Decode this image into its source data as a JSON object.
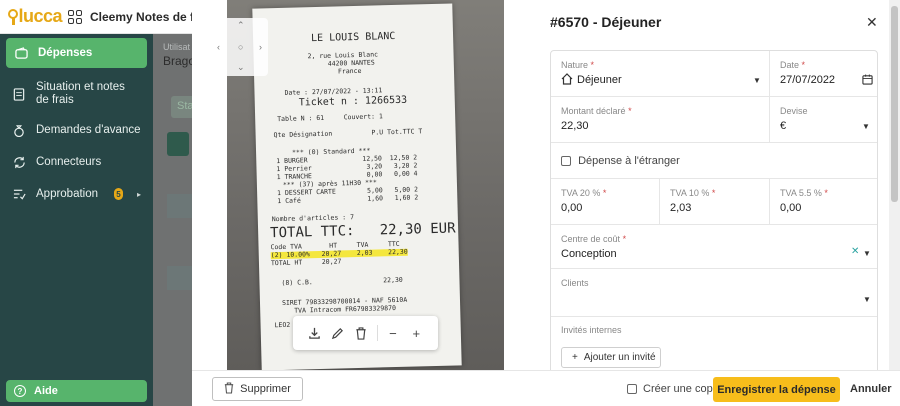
{
  "header": {
    "logo_text": "lucca",
    "app_title": "Cleemy Notes de frais"
  },
  "sidebar": {
    "items": [
      {
        "label": "Dépenses",
        "icon": "wallet-icon",
        "active": true
      },
      {
        "label": "Situation et notes de frais",
        "icon": "document-icon"
      },
      {
        "label": "Demandes d'avance",
        "icon": "moneybag-icon"
      },
      {
        "label": "Connecteurs",
        "icon": "sync-icon"
      },
      {
        "label": "Approbation",
        "icon": "checklist-icon",
        "badge": "5"
      }
    ],
    "help_label": "Aide"
  },
  "background": {
    "user_label": "Utilisat",
    "user_name": "Bragou",
    "tag": "Sta"
  },
  "receipt": {
    "restaurant": "LE LOUIS BLANC",
    "address": "2, rue Louis Blanc",
    "city": "44200 NANTES",
    "country": "France",
    "date_line": "Date : 27/07/2022 - 13:11",
    "ticket": "Ticket n : 1266533",
    "table_line": "Table N : 61     Couvert: 1",
    "columns": "Qte Désignation          P.U Tot.TTC T",
    "standard": "*** (0) Standard ***",
    "line1": "1 BURGER              12,50  12,50 2",
    "line2": "1 Perrier              3,20   3,20 2",
    "line3": "1 TRANCHE              0,00   0,00 4",
    "apres": "*** (37) après 11H30 ***",
    "line4": "1 DESSERT CARTE        5,00   5,00 2",
    "line5": "1 Café                 1,60   1,60 2",
    "nb_articles": "Nombre d'articles : 7",
    "total": "TOTAL TTC:   22,30 EUR",
    "tva_head": "Code TVA       HT     TVA     TTC",
    "tva_row": "(2) 10.00%   20,27    2,03    22,30",
    "total_ht": "TOTAL HT     20,27",
    "payment": "(8) C.B.                  22,30",
    "siret": "SIRET 79833298700014 - NAF 5610A",
    "tva_intra": "TVA Intracom FR67983329870",
    "leo": "LEO2"
  },
  "viewer_tools": [
    "download-icon",
    "pencil-icon",
    "trash-icon",
    "zoom-out-icon",
    "zoom-in-icon"
  ],
  "form": {
    "title": "#6570 - Déjeuner",
    "nature_label": "Nature",
    "nature_value": "Déjeuner",
    "date_label": "Date",
    "date_value": "27/07/2022",
    "amount_label": "Montant déclaré",
    "amount_value": "22,30",
    "currency_label": "Devise",
    "currency_value": "€",
    "abroad_label": "Dépense à l'étranger",
    "tva20_label": "TVA 20 %",
    "tva20_value": "0,00",
    "tva10_label": "TVA 10 %",
    "tva10_value": "2,03",
    "tva55_label": "TVA 5.5 %",
    "tva55_value": "0,00",
    "cost_center_label": "Centre de coût",
    "cost_center_value": "Conception",
    "clients_label": "Clients",
    "guests_label": "Invités internes",
    "add_guest_label": "Ajouter un invité"
  },
  "footer": {
    "delete_label": "Supprimer",
    "copy_label": "Créer une copie",
    "save_label": "Enregistrer la dépense",
    "cancel_label": "Annuler"
  }
}
